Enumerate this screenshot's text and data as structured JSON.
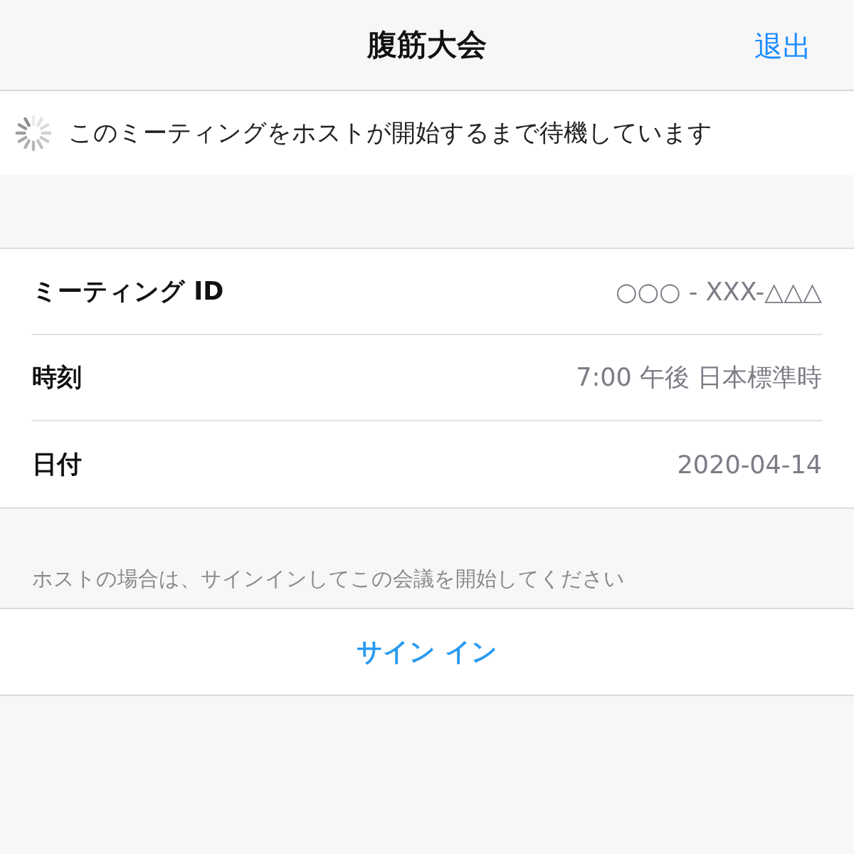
{
  "nav": {
    "title": "腹筋大会",
    "action": "退出"
  },
  "status": {
    "message": "このミーティングをホストが開始するまで待機しています"
  },
  "details": [
    {
      "label": "ミーティング ID",
      "value": "○○○ - XXX-△△△"
    },
    {
      "label": "時刻",
      "value": "7:00 午後 日本標準時"
    },
    {
      "label": "日付",
      "value": "2020-04-14"
    }
  ],
  "host_note": "ホストの場合は、サインインしてこの会議を開始してください",
  "sign_in": "サイン イン"
}
